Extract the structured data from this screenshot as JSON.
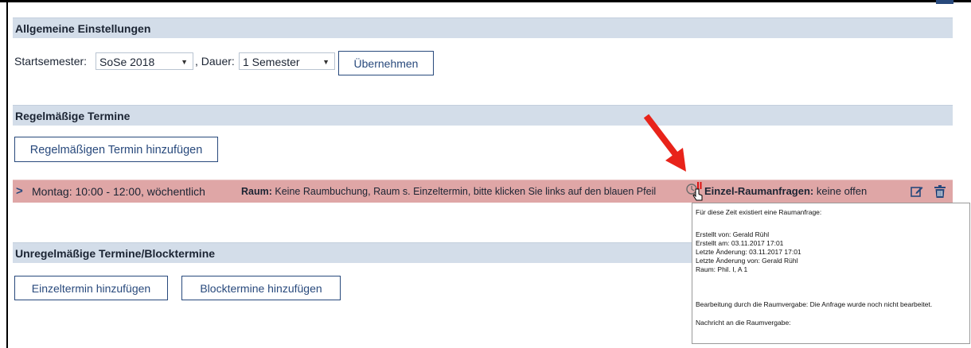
{
  "sections": {
    "general": {
      "title": "Allgemeine Einstellungen",
      "start_label": "Startsemester:",
      "start_value": "SoSe 2018",
      "duration_label": ", Dauer:",
      "duration_value": "1 Semester",
      "apply_button": "Übernehmen"
    },
    "regular": {
      "title": "Regelmäßige Termine",
      "add_button": "Regelmäßigen Termin hinzufügen",
      "row": {
        "time": "Montag: 10:00 - 12:00, wöchentlich",
        "room_label": "Raum:",
        "room_text": "Keine Raumbuchung, Raum s. Einzeltermin, bitte klicken Sie links auf den blauen Pfeil",
        "requests_label": "Einzel-Raumanfragen:",
        "requests_value": "keine offen"
      }
    },
    "irregular": {
      "title": "Unregelmäßige Termine/Blocktermine",
      "single_button": "Einzeltermin hinzufügen",
      "block_button": "Blocktermine hinzufügen"
    }
  },
  "tooltip": {
    "line1": "Für diese Zeit existiert eine Raumanfrage:",
    "created_by": "Erstellt von: Gerald Rühl",
    "created_at": "Erstellt am: 03.11.2017 17:01",
    "last_change": "Letzte Änderung: 03.11.2017 17:01",
    "last_change_by": "Letzte Änderung von: Gerald Rühl",
    "room": "Raum: Phil. I, A 1",
    "processing": "Bearbeitung durch die Raumvergabe: Die Anfrage wurde noch nicht bearbeitet.",
    "message": "Nachricht an die Raumvergabe:"
  },
  "colors": {
    "section_bg": "#d3dde9",
    "row_bg": "#dfa6a6",
    "accent": "#28497c",
    "arrow": "#e8231a"
  }
}
